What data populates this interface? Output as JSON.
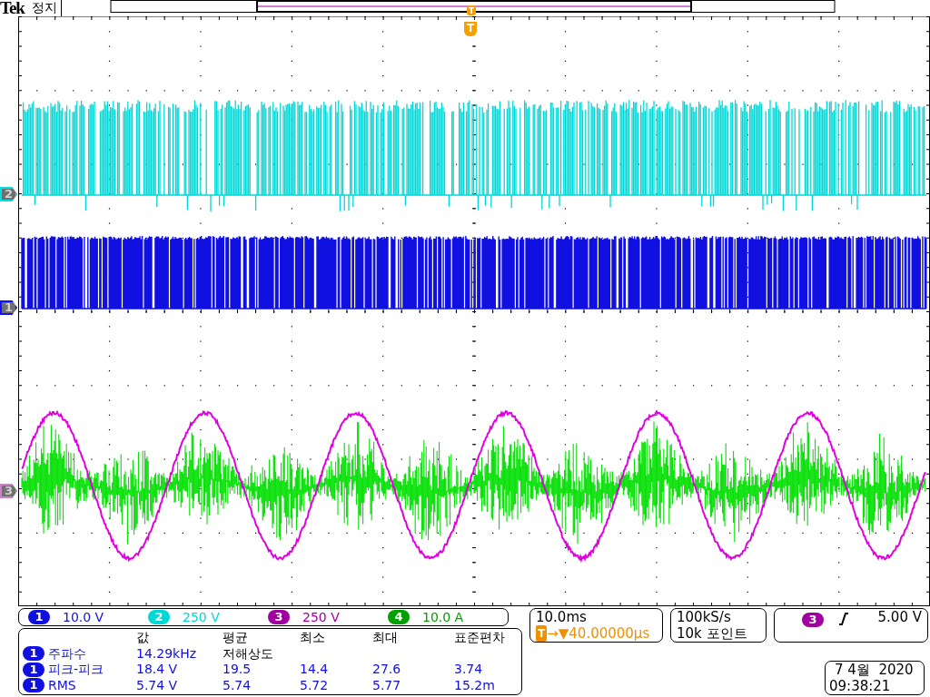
{
  "status_bar": {
    "brand": "Tek",
    "state": "정지"
  },
  "record_view": {
    "trigger_label": "T"
  },
  "trigger_marker": {
    "label": "T"
  },
  "waveform_markers": [
    {
      "label": "2",
      "color": "#00e0e0"
    },
    {
      "label": "1",
      "color": "#1010ff"
    },
    {
      "label": "3",
      "color": "#d080c8"
    }
  ],
  "channels": [
    {
      "number": "1",
      "scale": "10.0 V",
      "color": "#1010e0"
    },
    {
      "number": "2",
      "scale": "250 V",
      "color": "#00d8d8"
    },
    {
      "number": "3",
      "scale": "250 V",
      "color": "#a000a0"
    },
    {
      "number": "4",
      "scale": "10.0 A",
      "color": "#00a000"
    }
  ],
  "measurements": {
    "columns": [
      "값",
      "평균",
      "최소",
      "최대",
      "표준편차"
    ],
    "rows": [
      {
        "channel": "1",
        "name": "주파수",
        "values": [
          "14.29kHz"
        ],
        "note": "저해상도"
      },
      {
        "channel": "1",
        "name": "피크-피크",
        "values": [
          "18.4 V",
          "19.5",
          "14.4",
          "27.6",
          "3.74"
        ]
      },
      {
        "channel": "1",
        "name": "RMS",
        "values": [
          "5.74 V",
          "5.74",
          "5.72",
          "5.77",
          "15.2m"
        ]
      }
    ]
  },
  "timebase": {
    "scale": "10.0ms",
    "trigger_label": "T",
    "position": "→▼40.00000µs"
  },
  "acquisition": {
    "rate": "100kS/s",
    "points": "10k 포인트"
  },
  "trigger": {
    "source": "3",
    "level": "5.00 V"
  },
  "clock": {
    "date": "7 4월  2020",
    "time": "09:38:21"
  }
}
